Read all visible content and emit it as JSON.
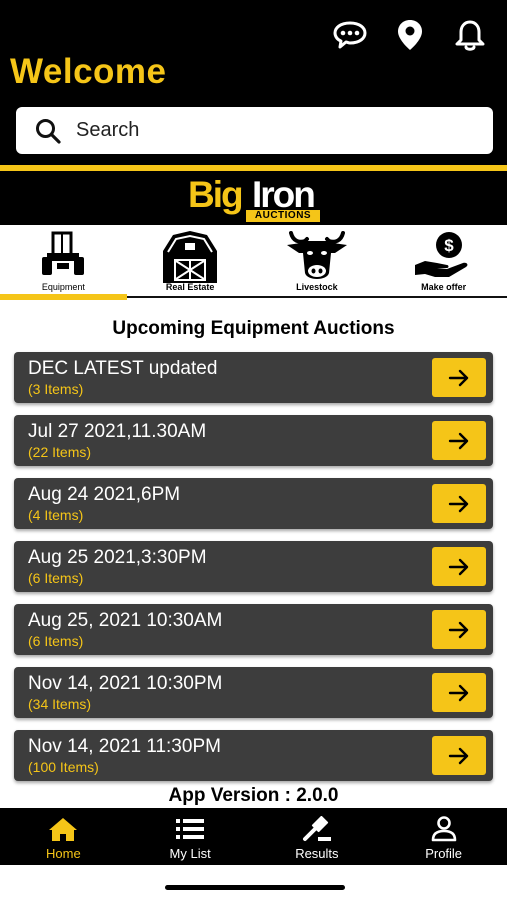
{
  "header": {
    "welcome": "Welcome",
    "icons": [
      "chat-icon",
      "location-pin-icon",
      "bell-icon"
    ]
  },
  "search": {
    "placeholder": "Search"
  },
  "brand": {
    "name_part1": "Big",
    "name_part2": "Iron",
    "sub": "AUCTIONS"
  },
  "categories": [
    {
      "label": "Equipment",
      "icon": "tractor-icon",
      "active": true
    },
    {
      "label": "Real Estate",
      "icon": "barn-icon",
      "active": false
    },
    {
      "label": "Livestock",
      "icon": "cow-icon",
      "active": false
    },
    {
      "label": "Make offer",
      "icon": "offer-hand-icon",
      "active": false
    }
  ],
  "main": {
    "section_title": "Upcoming Equipment Auctions",
    "auctions": [
      {
        "name": "DEC LATEST updated",
        "count": "(3 Items)"
      },
      {
        "name": "Jul 27 2021,11.30AM",
        "count": "(22 Items)"
      },
      {
        "name": "Aug 24 2021,6PM",
        "count": "(4 Items)"
      },
      {
        "name": "Aug 25 2021,3:30PM",
        "count": "(6 Items)"
      },
      {
        "name": "Aug 25, 2021 10:30AM",
        "count": "(6 Items)"
      },
      {
        "name": "Nov 14, 2021 10:30PM",
        "count": "(34 Items)"
      },
      {
        "name": "Nov 14, 2021 11:30PM",
        "count": "(100 Items)"
      }
    ],
    "version": "App Version : 2.0.0"
  },
  "tabs": [
    {
      "label": "Home",
      "icon": "home-icon",
      "active": true
    },
    {
      "label": "My List",
      "icon": "list-icon",
      "active": false
    },
    {
      "label": "Results",
      "icon": "gavel-icon",
      "active": false
    },
    {
      "label": "Profile",
      "icon": "profile-icon",
      "active": false
    }
  ],
  "colors": {
    "accent": "#F5C518",
    "bar": "#000000",
    "card": "#3d3d3d"
  }
}
